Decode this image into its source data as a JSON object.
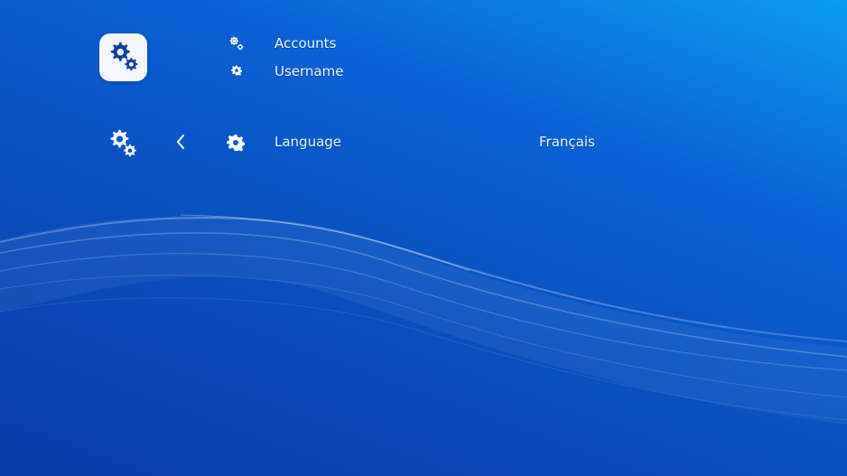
{
  "header": {
    "app_icon": "settings-gears-icon"
  },
  "menu": {
    "items": [
      {
        "label": "Accounts",
        "icon": "gears-icon"
      },
      {
        "label": "Username",
        "icon": "gear-icon"
      }
    ],
    "selected": {
      "label": "Language",
      "value": "Français",
      "icon": "gear-icon",
      "category_icon": "gears-icon",
      "back_icon": "chevron-left-icon"
    }
  },
  "colors": {
    "background_top": "#0a9bf0",
    "background_bottom": "#0a3aa8",
    "text": "#f2f6ff",
    "tile": "#f3f6fb",
    "tile_icon": "#0b3f9f"
  }
}
